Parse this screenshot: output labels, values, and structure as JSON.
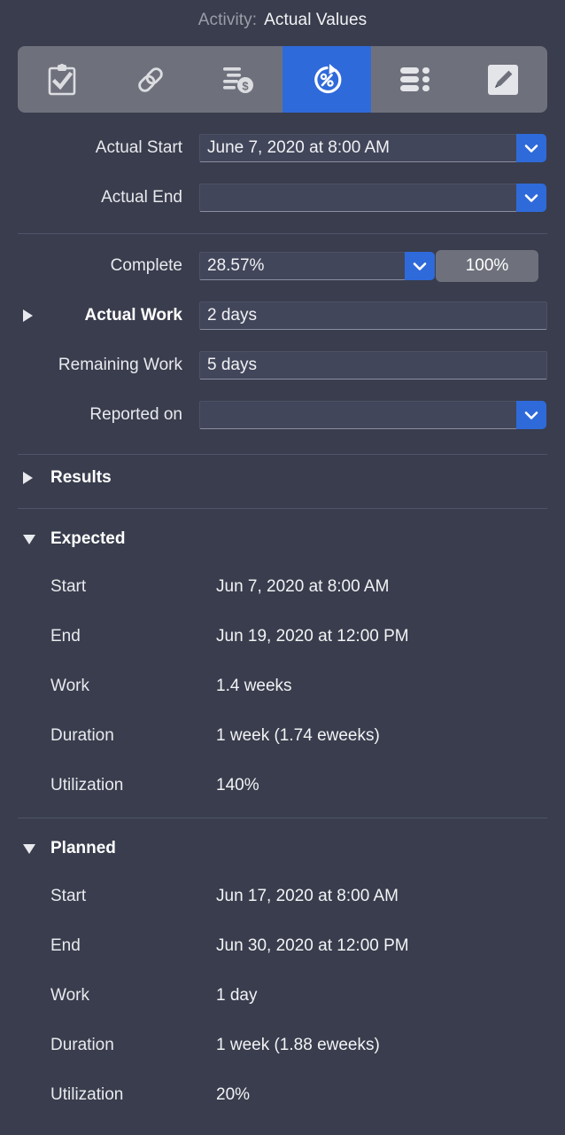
{
  "header": {
    "label": "Activity:",
    "title": "Actual Values"
  },
  "toolbar": {
    "items": [
      {
        "icon": "clipboard-check-icon",
        "name": "general",
        "selected": false
      },
      {
        "icon": "link-icon",
        "name": "links",
        "selected": false
      },
      {
        "icon": "cost-icon",
        "name": "costs",
        "selected": false
      },
      {
        "icon": "percent-progress-icon",
        "name": "actual-values",
        "selected": true
      },
      {
        "icon": "gantt-bars-icon",
        "name": "schedule",
        "selected": false
      },
      {
        "icon": "pencil-icon",
        "name": "notes",
        "selected": false
      }
    ]
  },
  "form": {
    "actual_start": {
      "label": "Actual Start",
      "value": "June 7, 2020 at 8:00 AM",
      "placeholder": ""
    },
    "actual_end": {
      "label": "Actual End",
      "value": "",
      "placeholder": ""
    },
    "complete": {
      "label": "Complete",
      "value": "28.57%",
      "placeholder": "",
      "button_label": "100%"
    },
    "actual_work": {
      "label": "Actual Work",
      "value": "2 days",
      "placeholder": ""
    },
    "remaining_work": {
      "label": "Remaining Work",
      "value": "5 days",
      "placeholder": ""
    },
    "reported_on": {
      "label": "Reported on",
      "value": "",
      "placeholder": ""
    }
  },
  "sections": {
    "results": {
      "title": "Results",
      "expanded": false
    },
    "expected": {
      "title": "Expected",
      "expanded": true,
      "rows": [
        {
          "key": "Start",
          "value": "Jun 7, 2020 at 8:00 AM"
        },
        {
          "key": "End",
          "value": "Jun 19, 2020 at 12:00 PM"
        },
        {
          "key": "Work",
          "value": "1.4 weeks"
        },
        {
          "key": "Duration",
          "value": "1 week (1.74 eweeks)"
        },
        {
          "key": "Utilization",
          "value": "140%"
        }
      ]
    },
    "planned": {
      "title": "Planned",
      "expanded": true,
      "rows": [
        {
          "key": "Start",
          "value": "Jun 17, 2020 at 8:00 AM"
        },
        {
          "key": "End",
          "value": "Jun 30, 2020 at 12:00 PM"
        },
        {
          "key": "Work",
          "value": "1 day"
        },
        {
          "key": "Duration",
          "value": "1 week (1.88 eweeks)"
        },
        {
          "key": "Utilization",
          "value": "20%"
        }
      ]
    }
  },
  "colors": {
    "background": "#393d4d",
    "accent": "#2f6ada",
    "toolbar_track": "#6e717c",
    "field_background": "#42465a",
    "text_primary": "#f2f3f5",
    "text_muted": "#9b9ea9"
  }
}
